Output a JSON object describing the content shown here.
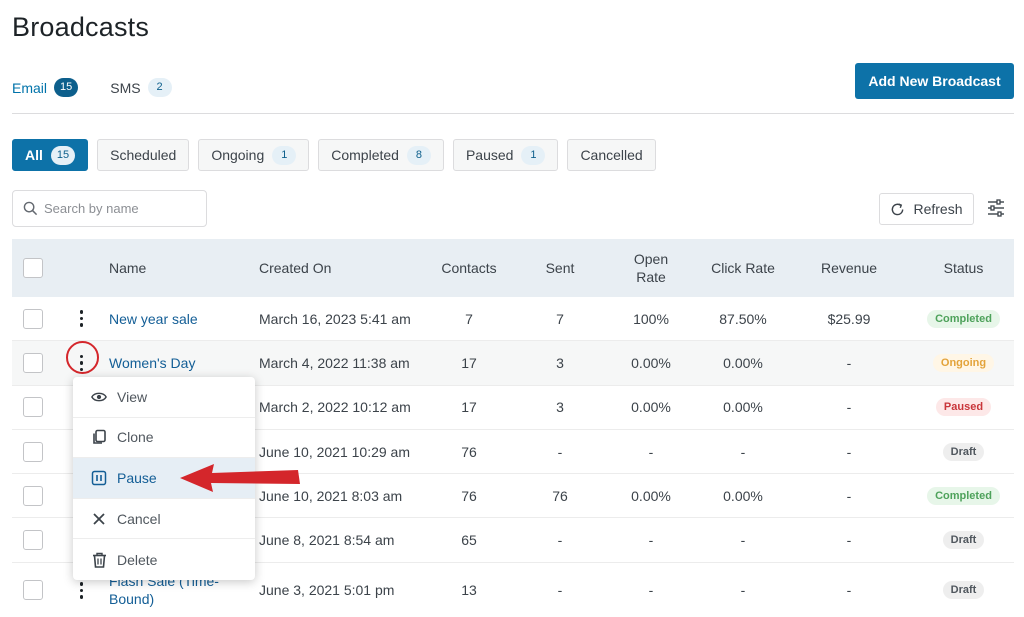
{
  "page": {
    "title": "Broadcasts"
  },
  "tabs": [
    {
      "label": "Email",
      "count": "15"
    },
    {
      "label": "SMS",
      "count": "2"
    }
  ],
  "add_button": "Add New Broadcast",
  "filters": [
    {
      "label": "All",
      "count": "15"
    },
    {
      "label": "Scheduled",
      "count": ""
    },
    {
      "label": "Ongoing",
      "count": "1"
    },
    {
      "label": "Completed",
      "count": "8"
    },
    {
      "label": "Paused",
      "count": "1"
    },
    {
      "label": "Cancelled",
      "count": ""
    }
  ],
  "search": {
    "placeholder": "Search by name"
  },
  "refresh_label": "Refresh",
  "columns": {
    "name": "Name",
    "created": "Created On",
    "contacts": "Contacts",
    "sent": "Sent",
    "open_rate_1": "Open",
    "open_rate_2": "Rate",
    "click_rate": "Click Rate",
    "revenue": "Revenue",
    "status": "Status"
  },
  "rows": [
    {
      "name": "New year sale",
      "created": "March 16, 2023 5:41 am",
      "contacts": "7",
      "sent": "7",
      "open_rate": "100%",
      "click_rate": "87.50%",
      "revenue": "$25.99",
      "status": "Completed"
    },
    {
      "name": "Women's Day",
      "created": "March 4, 2022 11:38 am",
      "contacts": "17",
      "sent": "3",
      "open_rate": "0.00%",
      "click_rate": "0.00%",
      "revenue": "-",
      "status": "Ongoing"
    },
    {
      "name": "",
      "created": "March 2, 2022 10:12 am",
      "contacts": "17",
      "sent": "3",
      "open_rate": "0.00%",
      "click_rate": "0.00%",
      "revenue": "-",
      "status": "Paused"
    },
    {
      "name": "",
      "created": "June 10, 2021 10:29 am",
      "contacts": "76",
      "sent": "-",
      "open_rate": "-",
      "click_rate": "-",
      "revenue": "-",
      "status": "Draft"
    },
    {
      "name": "",
      "created": "June 10, 2021 8:03 am",
      "contacts": "76",
      "sent": "76",
      "open_rate": "0.00%",
      "click_rate": "0.00%",
      "revenue": "-",
      "status": "Completed"
    },
    {
      "name": "",
      "created": "June 8, 2021 8:54 am",
      "contacts": "65",
      "sent": "-",
      "open_rate": "-",
      "click_rate": "-",
      "revenue": "-",
      "status": "Draft"
    },
    {
      "name": "Flash Sale (Time-Bound)",
      "created": "June 3, 2021 5:01 pm",
      "contacts": "13",
      "sent": "-",
      "open_rate": "-",
      "click_rate": "-",
      "revenue": "-",
      "status": "Draft"
    }
  ],
  "menu": [
    {
      "label": "View",
      "icon": "eye-icon"
    },
    {
      "label": "Clone",
      "icon": "copy-icon"
    },
    {
      "label": "Pause",
      "icon": "pause-icon"
    },
    {
      "label": "Cancel",
      "icon": "close-icon"
    },
    {
      "label": "Delete",
      "icon": "trash-icon"
    }
  ],
  "status_colors": {
    "Completed": {
      "bg": "#e7f6e9",
      "fg": "#4ea25b"
    },
    "Ongoing": {
      "bg": "#fff6e6",
      "fg": "#e3a33a"
    },
    "Paused": {
      "bg": "#fde8e8",
      "fg": "#c9353a"
    },
    "Draft": {
      "bg": "#eeeeee",
      "fg": "#50575e"
    }
  },
  "colors": {
    "primary": "#0d72a8",
    "link": "#135e96",
    "annotation": "#d4262b"
  }
}
